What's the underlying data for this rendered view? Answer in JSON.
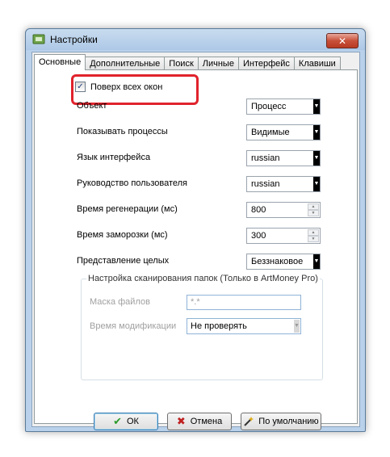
{
  "window": {
    "title": "Настройки",
    "close_label": "✕"
  },
  "tabs": [
    {
      "label": "Основные",
      "active": true
    },
    {
      "label": "Дополнительные",
      "active": false
    },
    {
      "label": "Поиск",
      "active": false
    },
    {
      "label": "Личные",
      "active": false
    },
    {
      "label": "Интерфейс",
      "active": false
    },
    {
      "label": "Клавиши",
      "active": false
    }
  ],
  "on_top_checkbox": {
    "label": "Поверх всех окон",
    "checked": true,
    "mark": "✓"
  },
  "settings": {
    "object": {
      "label": "Объект",
      "value": "Процесс"
    },
    "show_processes": {
      "label": "Показывать процессы",
      "value": "Видимые"
    },
    "interface_lang": {
      "label": "Язык интерфейса",
      "value": "russian"
    },
    "user_manual": {
      "label": "Руководство пользователя",
      "value": "russian"
    },
    "regen_time": {
      "label": "Время регенерации (мс)",
      "value": "800"
    },
    "freeze_time": {
      "label": "Время заморозки (мс)",
      "value": "300"
    },
    "int_repr": {
      "label": "Представление целых",
      "value": "Беззнаковое"
    }
  },
  "scan_group": {
    "title": "Настройка сканирования папок (Только в ArtMoney Pro)",
    "file_mask": {
      "label": "Маска файлов",
      "value": "*.*"
    },
    "mod_time": {
      "label": "Время модификации",
      "value": "Не проверять"
    }
  },
  "buttons": {
    "ok": "ОК",
    "cancel": "Отмена",
    "default": "По умолчанию"
  },
  "colors": {
    "highlight": "#e0232c",
    "ok_check": "#2a9a2a",
    "cancel_x": "#c02020"
  }
}
